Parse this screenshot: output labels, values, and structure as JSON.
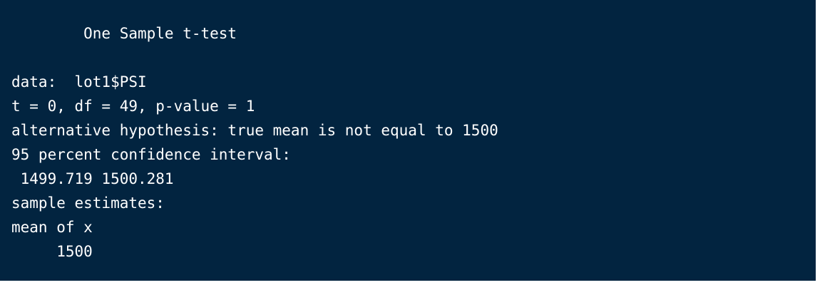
{
  "console": {
    "background_color": "#022440",
    "text_color": "#ffffff",
    "lines": {
      "title": "        One Sample t-test",
      "blank": "",
      "data": "data:  lot1$PSI",
      "statistics": "t = 0, df = 49, p-value = 1",
      "alternative": "alternative hypothesis: true mean is not equal to 1500",
      "confidence_label": "95 percent confidence interval:",
      "confidence_values": " 1499.719 1500.281",
      "estimates_label": "sample estimates:",
      "mean_label": "mean of x",
      "mean_value": "     1500"
    }
  }
}
